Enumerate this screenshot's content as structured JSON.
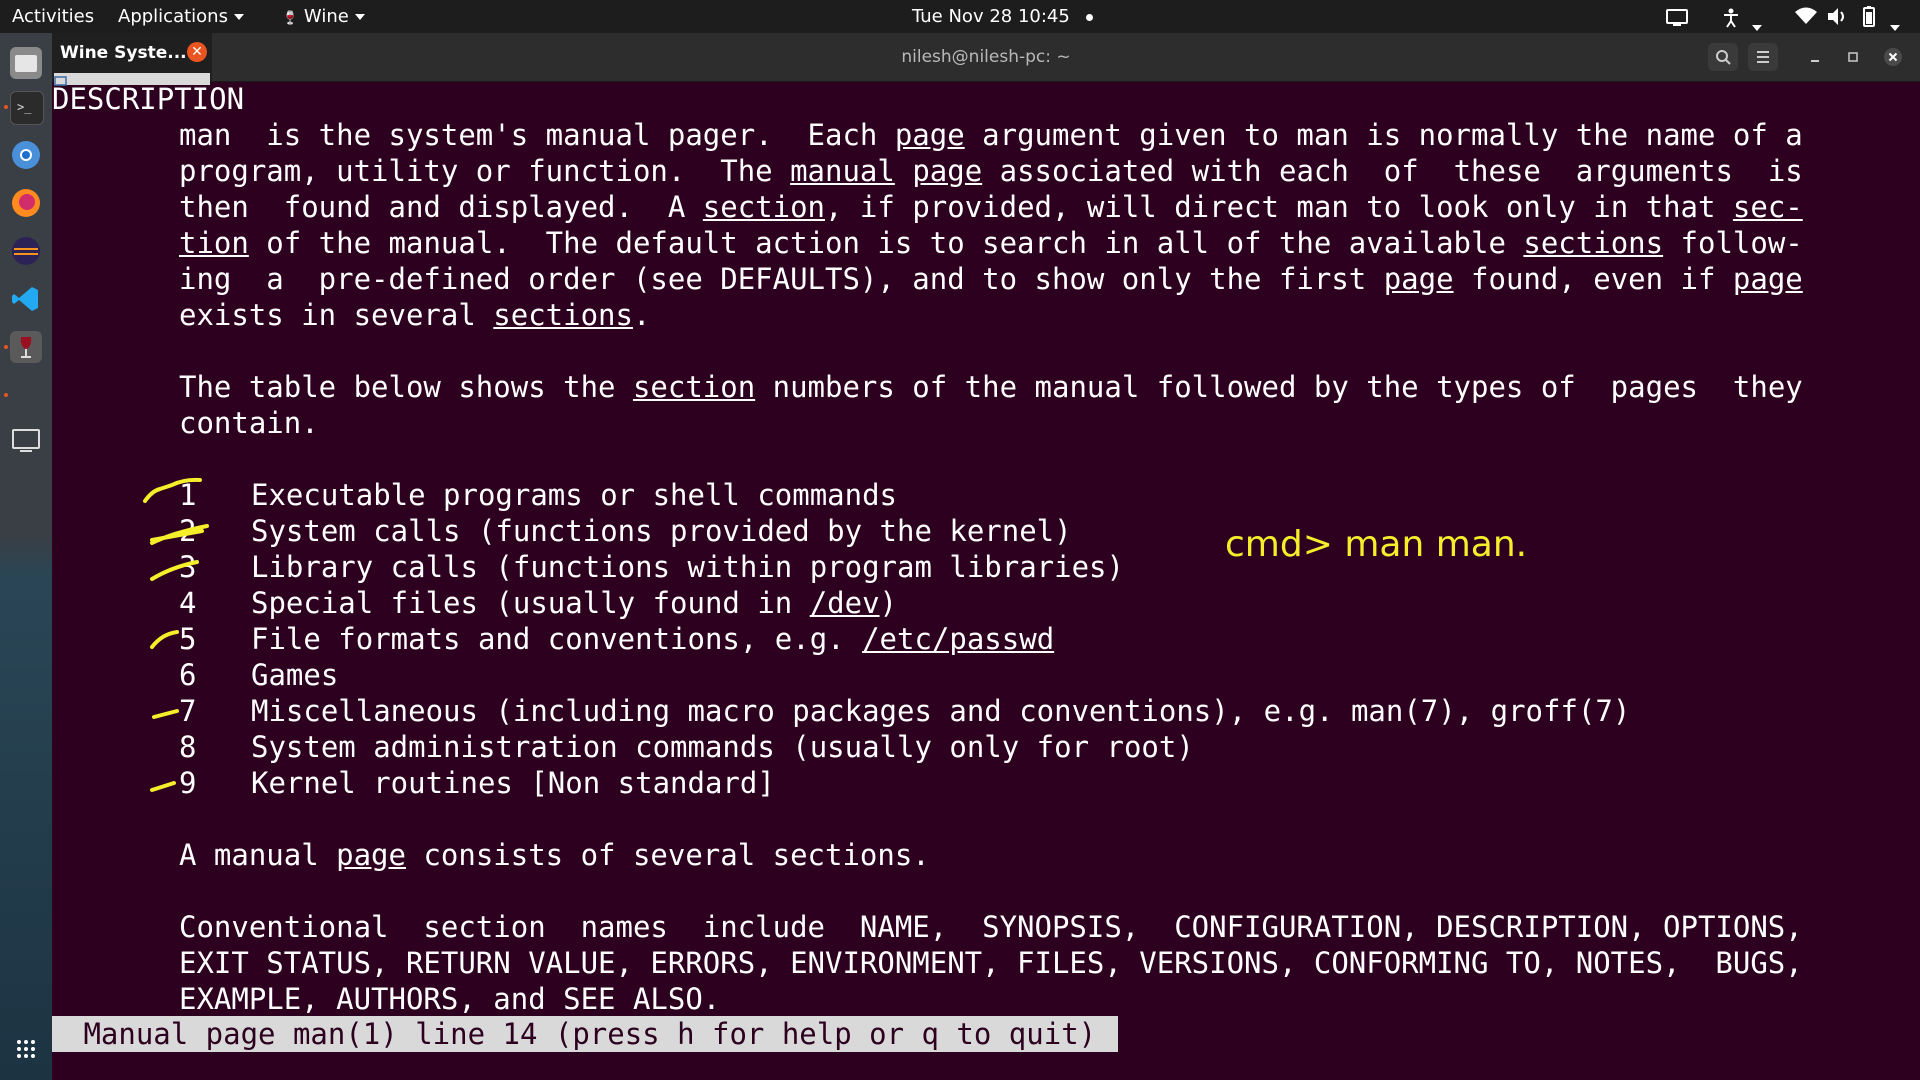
{
  "topbar": {
    "activities": "Activities",
    "applications": "Applications",
    "wine": "Wine",
    "clock": "Tue Nov 28  10:45"
  },
  "wine_tab": {
    "label": "Wine Syste..."
  },
  "window": {
    "title": "nilesh@nilesh-pc: ~"
  },
  "terminal": {
    "heading": "DESCRIPTION",
    "para1": [
      [
        "man  is the system's manual pager.  Each ",
        "page",
        " argument given to man is normally the name of a"
      ],
      [
        "program, utility or function.  The ",
        "manual",
        " ",
        "page",
        " associated with each  of  these  arguments  is"
      ],
      [
        "then  found and displayed.  A ",
        "section",
        ", if provided, will direct man to look only in that ",
        "sec-"
      ],
      [
        "",
        "tion",
        " of the manual.  The default action is to search in all of the available ",
        "sections",
        " follow-"
      ],
      [
        "ing  a  pre-defined order (see DEFAULTS), and to show only the first ",
        "page",
        " found, even if ",
        "page"
      ],
      [
        "exists in several ",
        "sections",
        "."
      ]
    ],
    "para2": [
      [
        "The table below shows the ",
        "section",
        " numbers of the manual followed by the types of  pages  they"
      ],
      [
        "contain."
      ]
    ],
    "sections": [
      {
        "num": "1",
        "desc": [
          "Executable programs or shell commands"
        ]
      },
      {
        "num": "2",
        "desc": [
          "System calls (functions provided by the kernel)"
        ]
      },
      {
        "num": "3",
        "desc": [
          "Library calls (functions within program libraries)"
        ]
      },
      {
        "num": "4",
        "desc": [
          "Special files (usually found in ",
          "/dev",
          ")"
        ]
      },
      {
        "num": "5",
        "desc": [
          "File formats and conventions, e.g. ",
          "/etc/passwd"
        ]
      },
      {
        "num": "6",
        "desc": [
          "Games"
        ]
      },
      {
        "num": "7",
        "desc": [
          "Miscellaneous (including macro packages and conventions), e.g. man(7), groff(7)"
        ]
      },
      {
        "num": "8",
        "desc": [
          "System administration commands (usually only for root)"
        ]
      },
      {
        "num": "9",
        "desc": [
          "Kernel routines [Non standard]"
        ]
      }
    ],
    "para3": [
      [
        "A manual ",
        "page",
        " consists of several sections."
      ]
    ],
    "para4": [
      [
        "Conventional  section  names  include  NAME,  SYNOPSIS,  CONFIGURATION, DESCRIPTION, OPTIONS,"
      ],
      [
        "EXIT STATUS, RETURN VALUE, ERRORS, ENVIRONMENT, FILES, VERSIONS, CONFORMING TO, NOTES,  BUGS,"
      ],
      [
        "EXAMPLE, AUTHORS, and SEE ALSO."
      ]
    ],
    "status": " Manual page man(1) line 14 (press h for help or q to quit)"
  },
  "annotation": {
    "text": "cmd> man man."
  },
  "colors": {
    "terminal_bg": "#2c001e",
    "annotation": "#f5ee2a",
    "accent": "#e95420"
  },
  "icons": [
    "files-icon",
    "terminal-icon",
    "chromium-icon",
    "firefox-icon",
    "eclipse-icon",
    "vscode-icon",
    "wine-icon",
    "monitor-icon",
    "app-grid-icon"
  ]
}
